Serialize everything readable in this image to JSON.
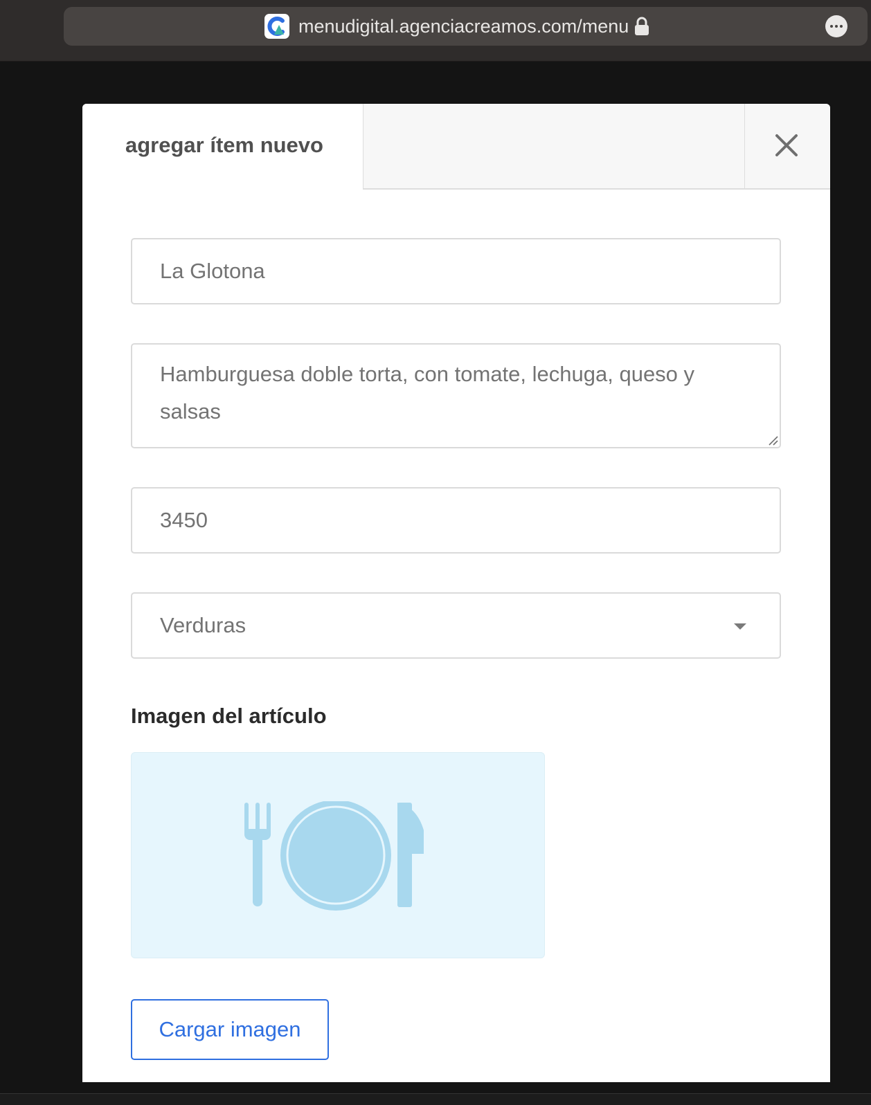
{
  "browser": {
    "url": "menudigital.agenciacreamos.com/menu",
    "icons": {
      "favicon": "site-logo-icon",
      "lock": "lock-icon",
      "more": "more-options-icon"
    }
  },
  "modal": {
    "tab_title": "agregar ítem nuevo",
    "close_icon": "close-icon",
    "fields": {
      "name": "La Glotona",
      "description": "Hamburguesa doble torta, con tomate, lechuga, queso y salsas",
      "price": "3450",
      "category": "Verduras"
    },
    "image_section_label": "Imagen del artículo",
    "image_placeholder_icon": "plate-cutlery-icon",
    "upload_button_label": "Cargar imagen"
  },
  "colors": {
    "accent": "#2f6fe0",
    "placeholder_bg": "#e6f6fd",
    "placeholder_icon": "#a8d8ee"
  }
}
